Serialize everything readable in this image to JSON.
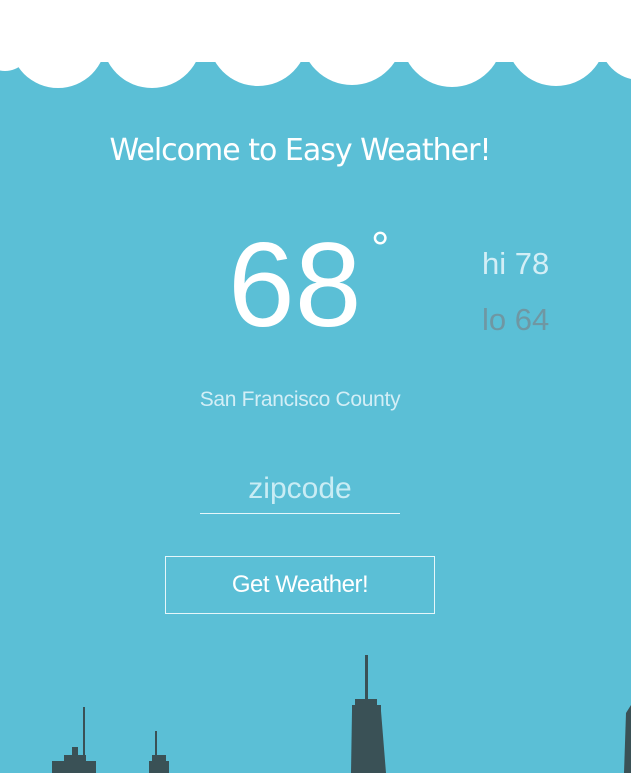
{
  "header": {
    "title": "Welcome to Easy Weather!"
  },
  "weather": {
    "temperature": "68",
    "degree_symbol": "°",
    "high": "hi 78",
    "low": "lo 64",
    "location": "San Francisco County"
  },
  "form": {
    "zipcode_placeholder": "zipcode",
    "zipcode_value": "",
    "submit_label": "Get Weather!"
  },
  "colors": {
    "background": "#5bbfd6",
    "clouds": "#ffffff",
    "skyline": "#3a5156",
    "high_text": "#d3eef6",
    "low_text": "#6f97a3"
  },
  "icons": {
    "clouds": "cloud-border-icon",
    "skyline": "city-skyline-icon"
  }
}
